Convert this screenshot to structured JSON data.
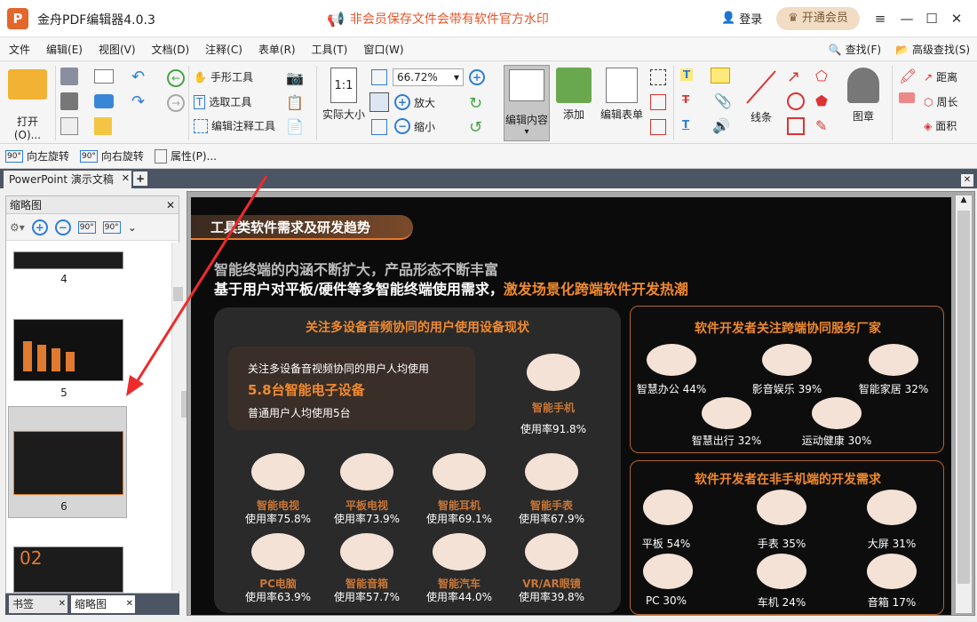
{
  "app": {
    "title": "金舟PDF编辑器4.0.3",
    "notice": "非会员保存文件会带有软件官方水印",
    "login": "登录",
    "member": "开通会员"
  },
  "menu": [
    "文件",
    "编辑(E)",
    "视图(V)",
    "文档(D)",
    "注释(C)",
    "表单(R)",
    "工具(T)",
    "窗口(W)"
  ],
  "menu_right": {
    "find": "查找(F)",
    "advanced_find": "高级查找(S)"
  },
  "ribbon": {
    "open": "打开(O)...",
    "hand_tool": "手形工具",
    "select_text": "选取工具",
    "edit_annotation": "编辑注释工具",
    "actual_size": "实际大小",
    "zoom_value": "66.72%",
    "zoom_in": "放大",
    "zoom_out": "缩小",
    "edit_content": "编辑内容",
    "add": "添加",
    "edit_form": "编辑表单",
    "line": "线条",
    "stamp": "图章",
    "distance": "距离",
    "perimeter": "周长",
    "area": "面积"
  },
  "quick": {
    "rotate_left": "向左旋转",
    "rotate_right": "向右旋转",
    "properties": "属性(P)..."
  },
  "doc_tab": "PowerPoint 演示文稿",
  "thumb_panel": {
    "title": "缩略图",
    "pages": [
      "4",
      "5",
      "6"
    ],
    "tab_bookmark": "书签",
    "tab_thumb": "缩略图"
  },
  "slide": {
    "section": "工具类软件需求及研发趋势",
    "line1": "智能终端的内涵不断扩大，产品形态不断丰富",
    "line2a": "基于用户对平板/硬件等多智能终端使用需求，",
    "line2b": "激发场景化跨端软件开发热潮",
    "left_title": "关注多设备音频协同的用户使用设备现状",
    "inner_line1": "关注多设备音视频协同的用户人均使用",
    "inner_big": "5.8台智能电子设备",
    "inner_line3": "普通用户人均使用5台",
    "phone_name": "智能手机",
    "phone_rate": "使用率91.8%",
    "devices": [
      {
        "name": "智能电视",
        "rate": "使用率75.8%"
      },
      {
        "name": "平板电视",
        "rate": "使用率73.9%"
      },
      {
        "name": "智能耳机",
        "rate": "使用率69.1%"
      },
      {
        "name": "智能手表",
        "rate": "使用率67.9%"
      },
      {
        "name": "PC电脑",
        "rate": "使用率63.9%"
      },
      {
        "name": "智能音箱",
        "rate": "使用率57.7%"
      },
      {
        "name": "智能汽车",
        "rate": "使用率44.0%"
      },
      {
        "name": "VR/AR眼镜",
        "rate": "使用率39.8%"
      }
    ],
    "right1_title": "软件开发者关注跨端协同服务厂家",
    "right1_items": [
      "智慧办公 44%",
      "影音娱乐 39%",
      "智能家居 32%",
      "智慧出行 32%",
      "运动健康 30%"
    ],
    "right2_title": "软件开发者在非手机端的开发需求",
    "right2_items": [
      "平板 54%",
      "手表 35%",
      "大屏 31%",
      "PC 30%",
      "车机 24%",
      "音箱 17%"
    ]
  }
}
